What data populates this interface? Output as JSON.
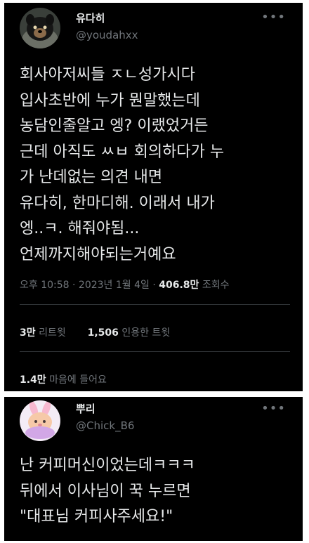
{
  "tweet1": {
    "display_name": "유다히",
    "handle": "@youdahxx",
    "more_icon": "more-horizontal-icon",
    "text": "회사아저씨들 ㅈㄴ성가시다\n입사초반에 누가 뭔말했는데\n농담인줄알고 엥? 이랬었거든\n근데 아직도 ㅆㅂ 회의하다가 누\n가 난데없는 의견 내면\n유다히, 한마디해. 이래서 내가\n엥..ㅋ. 해줘야됨...\n언제까지해야되는거예요",
    "time": "오후 10:58",
    "date": "2023년 1월 4일",
    "views_count": "406.8만",
    "views_label": "조회수",
    "retweets_count": "3만",
    "retweets_label": "리트윗",
    "quotes_count": "1,506",
    "quotes_label": "인용한 트윗",
    "likes_count": "1.4만",
    "likes_label": "마음에 들어요"
  },
  "tweet2": {
    "display_name": "뿌리",
    "handle": "@Chick_B6",
    "more_icon": "more-horizontal-icon",
    "text": "난 커피머신이었는데ㅋㅋㅋ\n뒤에서 이사님이 꾹 누르면\n\"대표님 커피사주세요!\""
  },
  "colors": {
    "background": "#000000",
    "text": "#e7e9ea",
    "secondary": "#71767b",
    "divider": "#2f3336"
  }
}
